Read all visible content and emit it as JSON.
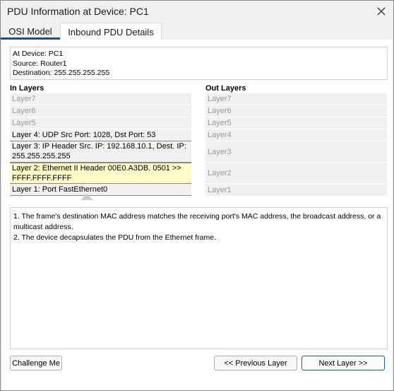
{
  "window": {
    "title": "PDU Information at Device: PC1",
    "close_icon": "close-icon"
  },
  "tabs": [
    {
      "label": "OSI Model"
    },
    {
      "label": "Inbound PDU Details"
    }
  ],
  "device_info": {
    "at_device": "At Device: PC1",
    "source": "Source: Router1",
    "destination": "Destination: 255.255.255.255"
  },
  "in_layers": {
    "title": "In Layers",
    "items": [
      {
        "label": "Layer7"
      },
      {
        "label": "Layer6"
      },
      {
        "label": "Layer5"
      },
      {
        "label": "Layer 4: UDP Src Port: 1028, Dst Port: 53"
      },
      {
        "label": "Layer 3: IP Header Src. IP: 192.168.10.1, Dest. IP: 255.255.255.255"
      },
      {
        "label": "Layer 2: Ethernet II Header 00E0.A3DB. 0501 >> FFFF.FFFF.FFFF"
      },
      {
        "label": "Layer 1: Port FastEthernet0"
      }
    ]
  },
  "out_layers": {
    "title": "Out Layers",
    "items": [
      {
        "label": "Layer7"
      },
      {
        "label": "Layer6"
      },
      {
        "label": "Layer5"
      },
      {
        "label": "Layer4"
      },
      {
        "label": "Layer3"
      },
      {
        "label": "Layer2"
      },
      {
        "label": "Layer1"
      }
    ]
  },
  "description": {
    "line1": "1. The frame's destination MAC address matches the receiving port's MAC address, the broadcast address, or a multicast address.",
    "line2": "2. The device decapsulates the PDU from the Ethernet frame."
  },
  "buttons": {
    "challenge": "Challenge Me",
    "previous": "<< Previous Layer",
    "next": "Next Layer >>"
  },
  "colors": {
    "selected_layer_bg": "#fdfbc6",
    "tab_underline": "#1e4e8c",
    "next_button_border": "#0a64b4"
  }
}
